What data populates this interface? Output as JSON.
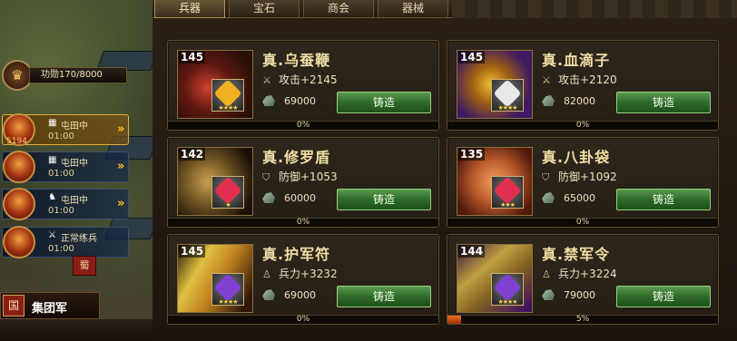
{
  "side": {
    "exploit_label": "功勋170/8000",
    "troops": [
      {
        "level": "5194",
        "state_icon": "field-icon",
        "state": "屯田中",
        "timer": "01:00",
        "active": true
      },
      {
        "level": "",
        "state_icon": "field-icon",
        "state": "屯田中",
        "timer": "01:00",
        "active": false
      },
      {
        "level": "",
        "state_icon": "horse-icon",
        "state": "屯田中",
        "timer": "01:00",
        "active": false
      },
      {
        "level": "",
        "state_icon": "training-icon",
        "state": "正常练兵",
        "timer": "01:00",
        "active": false
      }
    ],
    "arrows": "»",
    "faction_flag": "蜀",
    "legion_emblem": "国",
    "legion_label": "集团军"
  },
  "tabs": [
    "兵器",
    "宝石",
    "商会",
    "器械"
  ],
  "active_tab": 0,
  "weapons": [
    {
      "level": "145",
      "name": "真.乌蚕鞭",
      "stat_icon": "sword-icon",
      "stat": "攻击+2145",
      "cost": "69000",
      "button": "铸造",
      "progress": 0,
      "progress_label": "0%",
      "gem_color": "#f0b020"
    },
    {
      "level": "145",
      "name": "真.血滴子",
      "stat_icon": "sword-icon",
      "stat": "攻击+2120",
      "cost": "82000",
      "button": "铸造",
      "progress": 0,
      "progress_label": "0%",
      "gem_color": "#e8e8e8"
    },
    {
      "level": "142",
      "name": "真.修罗盾",
      "stat_icon": "shield-icon",
      "stat": "防御+1053",
      "cost": "60000",
      "button": "铸造",
      "progress": 0,
      "progress_label": "0%",
      "gem_color": "#e03050"
    },
    {
      "level": "135",
      "name": "真.八卦袋",
      "stat_icon": "shield-icon",
      "stat": "防御+1092",
      "cost": "65000",
      "button": "铸造",
      "progress": 0,
      "progress_label": "0%",
      "gem_color": "#e03050"
    },
    {
      "level": "145",
      "name": "真.护军符",
      "stat_icon": "soldier-icon",
      "stat": "兵力+3232",
      "cost": "69000",
      "button": "铸造",
      "progress": 0,
      "progress_label": "0%",
      "gem_color": "#8040d0"
    },
    {
      "level": "144",
      "name": "真.禁军令",
      "stat_icon": "soldier-icon",
      "stat": "兵力+3224",
      "cost": "79000",
      "button": "铸造",
      "progress": 0.05,
      "progress_label": "5%",
      "gem_color": "#8040d0"
    }
  ]
}
